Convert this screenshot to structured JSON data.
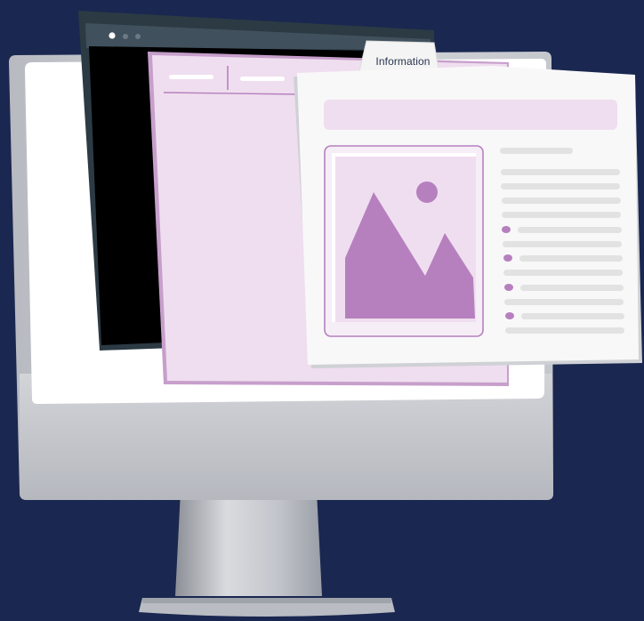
{
  "info_card": {
    "tab_label": "Information"
  },
  "dark_window": {
    "control_dots": 3
  },
  "colors": {
    "background": "#1a2750",
    "accent": "#b680bf",
    "panel_tint": "#efdeef",
    "card_white": "#f8f8f8",
    "text_line": "#e2e2e2",
    "monitor_silver": "#c9cbd0",
    "window_dark": "#2c3a44"
  },
  "icons": {
    "image_placeholder": "image-icon",
    "list_bullet": "bullet-icon"
  }
}
